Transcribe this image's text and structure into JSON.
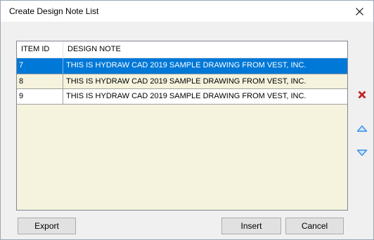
{
  "window": {
    "title": "Create Design Note List",
    "close_icon": "close-icon"
  },
  "list": {
    "columns": [
      "ITEM ID",
      "DESIGN NOTE"
    ],
    "rows": [
      {
        "id": "7",
        "note": "THIS IS HYDRAW CAD 2019 SAMPLE DRAWING FROM VEST, INC.",
        "selected": true
      },
      {
        "id": "8",
        "note": "THIS IS HYDRAW CAD 2019 SAMPLE DRAWING FROM VEST, INC.",
        "selected": false
      },
      {
        "id": "9",
        "note": "THIS IS HYDRAW CAD 2019 SAMPLE DRAWING FROM VEST, INC.",
        "selected": false
      }
    ]
  },
  "side_buttons": {
    "delete_icon": "delete-x-icon",
    "up_icon": "move-up-icon",
    "down_icon": "move-down-icon"
  },
  "buttons": {
    "export": "Export",
    "insert": "Insert",
    "cancel": "Cancel"
  },
  "colors": {
    "selection": "#0078d7",
    "list_background": "#f5f3dd",
    "delete_red": "#d9232a",
    "arrow_blue": "#3a8ee6"
  }
}
